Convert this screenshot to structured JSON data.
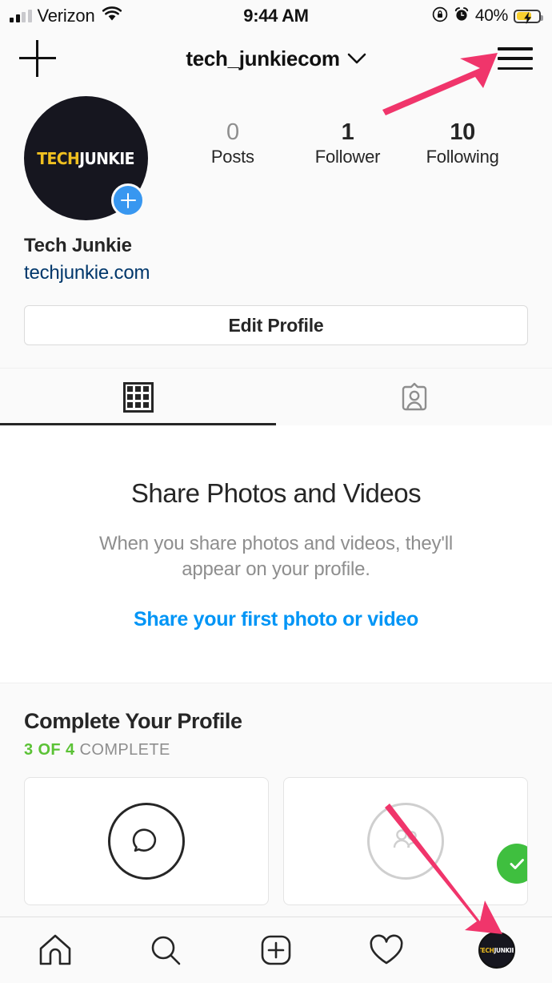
{
  "status_bar": {
    "carrier": "Verizon",
    "wifi_icon": "wifi-icon",
    "time": "9:44 AM",
    "rotation_lock_icon": "rotation-lock-icon",
    "alarm_icon": "alarm-clock-icon",
    "battery_percent": "40%",
    "battery_state": "charging",
    "battery_fill_color": "#f7cf2e"
  },
  "header": {
    "add_icon": "plus-icon",
    "username": "tech_junkiecom",
    "chevron_icon": "chevron-down-icon",
    "menu_icon": "hamburger-menu-icon"
  },
  "profile": {
    "avatar": {
      "logo_part1": "TECH",
      "logo_part2": "JUNKIE",
      "background_color": "#16161f",
      "accent_color": "#f0c020",
      "add_story_badge": "plus-badge-icon",
      "badge_color": "#3897f0"
    },
    "stats": [
      {
        "number": "0",
        "label": "Posts"
      },
      {
        "number": "1",
        "label": "Follower"
      },
      {
        "number": "10",
        "label": "Following"
      }
    ],
    "display_name": "Tech Junkie",
    "website": "techjunkie.com",
    "website_color": "#00376b",
    "edit_button": "Edit Profile"
  },
  "tabs": [
    {
      "name": "grid-tab",
      "icon": "grid-icon",
      "active": true
    },
    {
      "name": "tagged-tab",
      "icon": "person-card-icon",
      "active": false
    }
  ],
  "empty_state": {
    "title": "Share Photos and Videos",
    "description": "When you share photos and videos, they'll appear on your profile.",
    "cta": "Share your first photo or video",
    "cta_color": "#0095f6"
  },
  "complete_profile": {
    "title": "Complete Your Profile",
    "progress": "3 OF 4",
    "progress_suffix": "COMPLETE",
    "progress_color": "#5bc236",
    "cards": [
      {
        "name": "add-bio-card",
        "icon": "speech-bubble-icon",
        "done": false
      },
      {
        "name": "find-people-card",
        "icon": "people-icon",
        "done": true,
        "badge": "check-icon",
        "badge_color": "#3fbf3f"
      }
    ]
  },
  "bottom_nav": [
    {
      "name": "nav-home",
      "icon": "home-icon"
    },
    {
      "name": "nav-search",
      "icon": "search-icon"
    },
    {
      "name": "nav-add",
      "icon": "plus-square-icon"
    },
    {
      "name": "nav-activity",
      "icon": "heart-icon"
    },
    {
      "name": "nav-profile",
      "icon": "profile-avatar-icon",
      "active": true
    }
  ],
  "annotations": {
    "arrow_color": "#f0356b",
    "arrows": [
      {
        "name": "arrow-to-menu",
        "points_to": "hamburger-menu-icon"
      },
      {
        "name": "arrow-to-profile-tab",
        "points_to": "nav-profile"
      }
    ]
  }
}
